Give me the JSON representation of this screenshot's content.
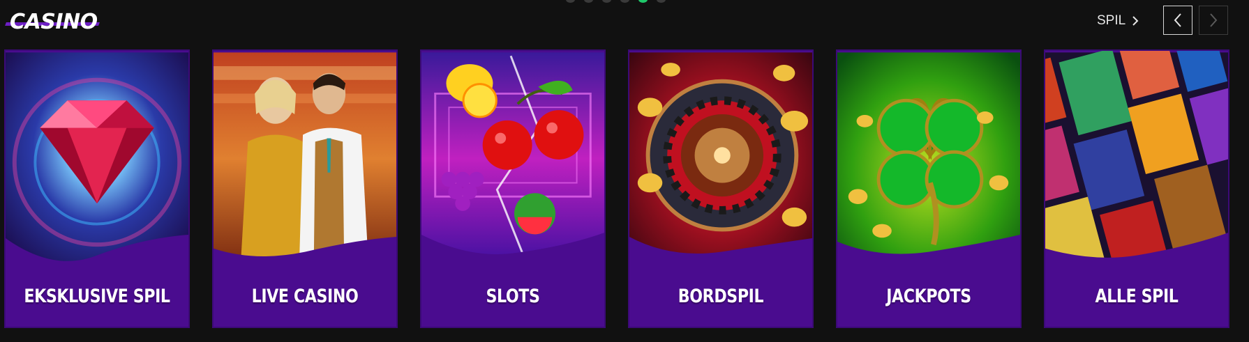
{
  "header": {
    "title": "CASINO",
    "more_link": "SPIL",
    "carousel_dots": 6,
    "active_dot": 4
  },
  "colors": {
    "background": "#111111",
    "card_purple": "#4a0c8f",
    "accent_green": "#1fc86a",
    "title_underline": "#6d1fc4"
  },
  "cards": [
    {
      "label": "EKSKLUSIVE SPIL",
      "icon": "diamond-icon"
    },
    {
      "label": "LIVE CASINO",
      "icon": "dealers-icon"
    },
    {
      "label": "SLOTS",
      "icon": "fruits-icon"
    },
    {
      "label": "BORDSPIL",
      "icon": "roulette-icon"
    },
    {
      "label": "JACKPOTS",
      "icon": "clover-icon"
    },
    {
      "label": "ALLE SPIL",
      "icon": "game-tiles-icon"
    }
  ]
}
